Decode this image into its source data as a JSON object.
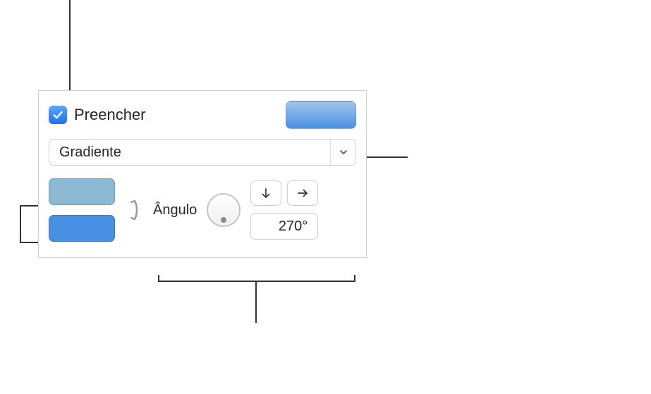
{
  "fill": {
    "checkbox_checked": true,
    "label": "Preencher",
    "type_dropdown": {
      "selected": "Gradiente"
    },
    "gradient": {
      "stop1_color": "#8db8d4",
      "stop2_color": "#4a90e2",
      "angle_label": "Ângulo",
      "angle_value": "270°"
    }
  },
  "icons": {
    "checkmark": "checkmark-icon",
    "chevron_down": "chevron-down-icon",
    "swap": "swap-arrows-icon",
    "arrow_down": "arrow-down-icon",
    "arrow_right": "arrow-right-icon"
  }
}
